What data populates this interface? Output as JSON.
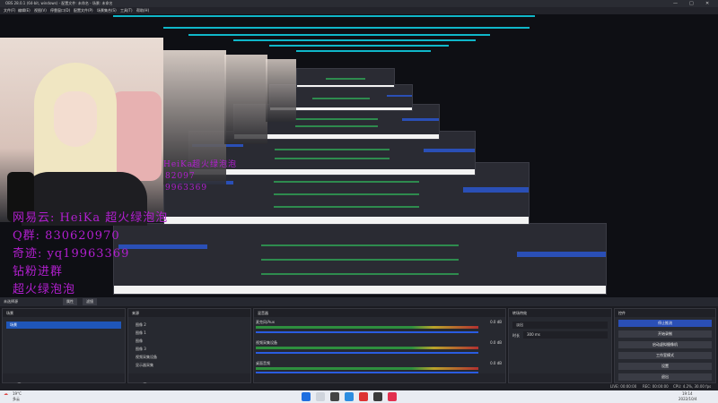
{
  "window": {
    "title": "OBS 28.0.1 (64-bit, windows) - 配置文件: 未命名 - 场景: 未命名",
    "controls": [
      "—",
      "□",
      "✕"
    ]
  },
  "menu": {
    "items": [
      "文件(F)",
      "编辑(E)",
      "视图(V)",
      "停靠窗口(D)",
      "配置文件(P)",
      "场景集合(S)",
      "工具(T)",
      "帮助(H)"
    ]
  },
  "overlay": {
    "lines": [
      "网易云: HeiKa 超火绿泡泡",
      "Q群: 830620970",
      "奇迹: yq19963369",
      "钻粉进群",
      "超火绿泡泡"
    ],
    "ghost_lines": [
      "超火绿泡泡",
      "HeiKa",
      "82097",
      "9963369"
    ]
  },
  "dock_bar": {
    "label": "未选择源",
    "properties": "属性",
    "filters": "滤镜"
  },
  "scenes": {
    "title": "场景",
    "items": [
      "场景"
    ],
    "footer": [
      "+",
      "🗑",
      "∧",
      "∨"
    ]
  },
  "sources": {
    "title": "来源",
    "items": [
      "图像 2",
      "图像 1",
      "图像",
      "图像 3",
      "视频采集设备",
      "显示器采集"
    ],
    "footer": [
      "+",
      "🗑",
      "⚙",
      "∧",
      "∨"
    ]
  },
  "mixer": {
    "title": "混音器",
    "channels": [
      {
        "name": "麦克风/Aux",
        "value": "0.0 dB",
        "level": 0.78
      },
      {
        "name": "视频采集设备",
        "value": "0.0 dB",
        "level": 0.55
      },
      {
        "name": "桌面音频",
        "value": "0.0 dB",
        "level": 0.62
      }
    ],
    "footer": [
      "⚙",
      "⋮"
    ]
  },
  "transitions": {
    "title": "转场特效",
    "type": "淡出",
    "duration_label": "时长",
    "duration_value": "300 ms",
    "footer": [
      "+",
      "⋮"
    ]
  },
  "controls": {
    "title": "控件",
    "buttons": [
      "停止推流",
      "开始录制",
      "启动虚拟摄像机",
      "工作室模式",
      "设置",
      "退出"
    ]
  },
  "statusbar": {
    "live": "LIVE: 00:00:00",
    "rec": "REC: 00:00:00",
    "cpu": "CPU: 4.2%, 30.00 fps"
  },
  "taskbar": {
    "weather_temp": "19°C",
    "weather_desc": "多云",
    "time": "19:14",
    "date": "2022/10/4"
  },
  "colors": {
    "accent": "#1f56b8",
    "overlay_text": "#b21fd0",
    "meter_green": "#2e8f3e"
  }
}
